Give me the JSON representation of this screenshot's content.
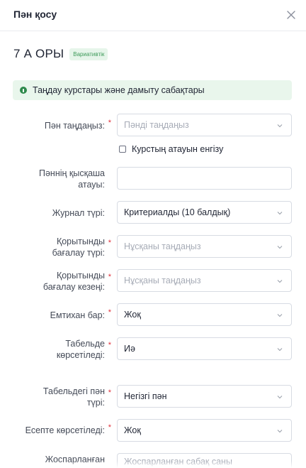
{
  "modal": {
    "title": "Пән қосу"
  },
  "class": {
    "name": "7 А ОРЫ",
    "badge": "Вариативтік"
  },
  "banner": {
    "text": "Таңдау курстары және дамыту сабақтары"
  },
  "fields": {
    "subject": {
      "label": "Пән таңдаңыз:",
      "placeholder": "Пәнді таңдаңыз"
    },
    "course_name_checkbox": {
      "label": "Курстың атауын енгізу"
    },
    "short_name": {
      "label_line1": "Пәннің қысқаша",
      "label_line2": "атауы:",
      "value": ""
    },
    "journal_type": {
      "label": "Журнал түрі:",
      "value": "Критериалды (10 балдық)"
    },
    "final_assessment_type": {
      "label_line1": "Қорытынды",
      "label_line2": "бағалау түрі:",
      "placeholder": "Нұсқаны таңдаңыз"
    },
    "final_assessment_period": {
      "label_line1": "Қорытынды",
      "label_line2": "бағалау кезеңі:",
      "placeholder": "Нұсқаны таңдаңыз"
    },
    "exam": {
      "label": "Емтихан бар:",
      "value": "Жоқ"
    },
    "show_in_table": {
      "label_line1": "Табельде",
      "label_line2": "көрсетіледі:",
      "value": "Иә"
    },
    "table_subject_type": {
      "label_line1": "Табельдегі пән",
      "label_line2": "түрі:",
      "value": "Негізгі пән"
    },
    "show_in_report": {
      "label": "Есепте көрсетіледі:",
      "value": "Жоқ"
    },
    "planned_lessons": {
      "label_line1": "Жоспарланған",
      "placeholder": "Жоспарланған сабақ саны"
    }
  },
  "required_mark": "*",
  "colors": {
    "required": "#e0303a",
    "badge_text": "#3e9a5a",
    "banner_bg": "#e9f6ec"
  }
}
